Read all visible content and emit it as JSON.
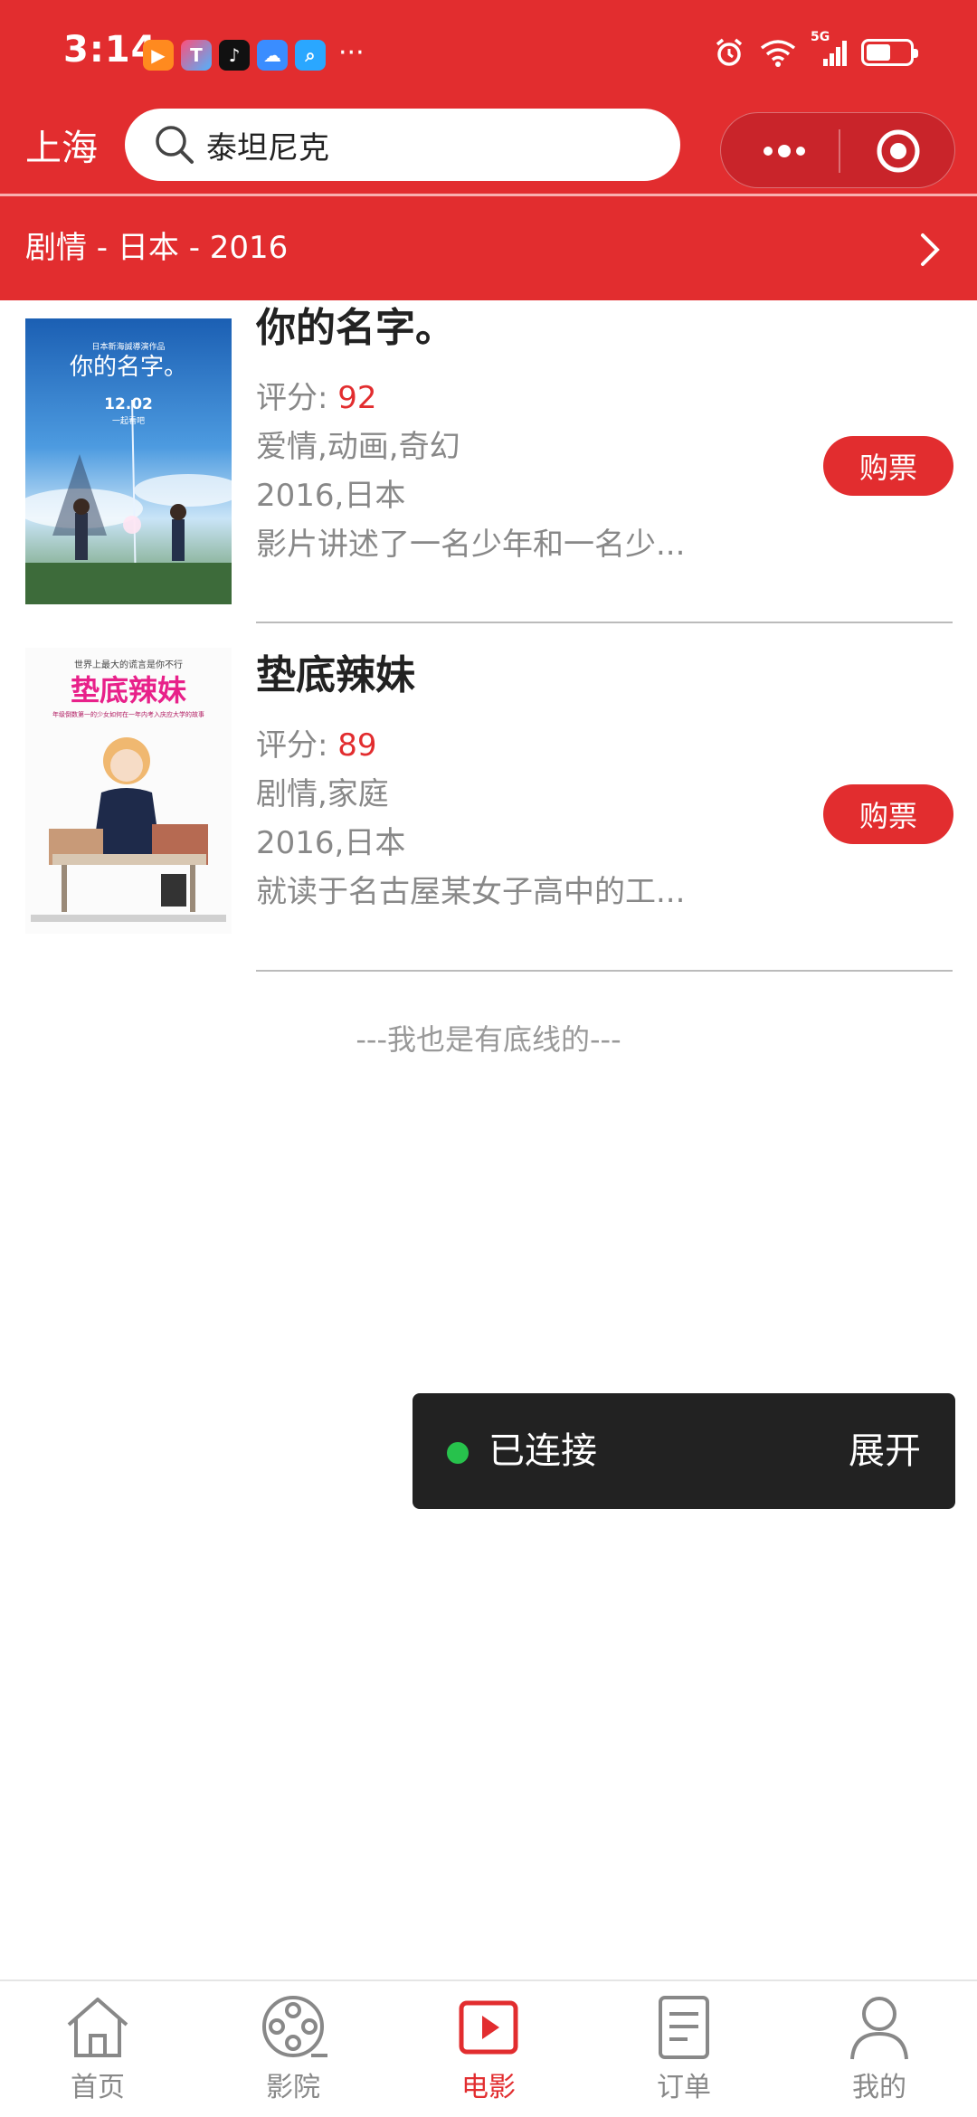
{
  "status_bar": {
    "time": "3:14",
    "more": "···",
    "network": "5G"
  },
  "header": {
    "city": "上海",
    "search": {
      "value": "泰坦尼克"
    }
  },
  "filter": {
    "text": "剧情 - 日本 - 2016"
  },
  "movies": [
    {
      "title": "你的名字。",
      "score_label": "评分:",
      "score": "92",
      "genres": "爱情,动画,奇幻",
      "year_region": "2016,日本",
      "synopsis": "影片讲述了一名少年和一名少...",
      "buy_label": "购票",
      "poster": {
        "top_text": "日本新海誠導演作品",
        "title_text": "你的名字。",
        "date_text": "12.02",
        "sub_text": "一起看吧"
      }
    },
    {
      "title": "垫底辣妹",
      "score_label": "评分:",
      "score": "89",
      "genres": "剧情,家庭",
      "year_region": "2016,日本",
      "synopsis": "就读于名古屋某女子高中的工...",
      "buy_label": "购票",
      "poster": {
        "top_text": "世界上最大的谎言是你不行",
        "title_text": "垫底辣妹",
        "sub_text": "年级倒数第一的少女如何在一年内考入庆应大学的故事"
      }
    }
  ],
  "footer_note": "---我也是有底线的---",
  "toast": {
    "status": "已连接",
    "expand": "展开"
  },
  "tabs": [
    {
      "label": "首页",
      "icon": "home-icon",
      "active": false
    },
    {
      "label": "影院",
      "icon": "film-reel-icon",
      "active": false
    },
    {
      "label": "电影",
      "icon": "play-icon",
      "active": true
    },
    {
      "label": "订单",
      "icon": "order-list-icon",
      "active": false
    },
    {
      "label": "我的",
      "icon": "user-icon",
      "active": false
    }
  ],
  "colors": {
    "brand_red": "#e22d2f",
    "toast_bg": "#222222",
    "connected_green": "#27c24c",
    "muted_text": "#888888"
  }
}
